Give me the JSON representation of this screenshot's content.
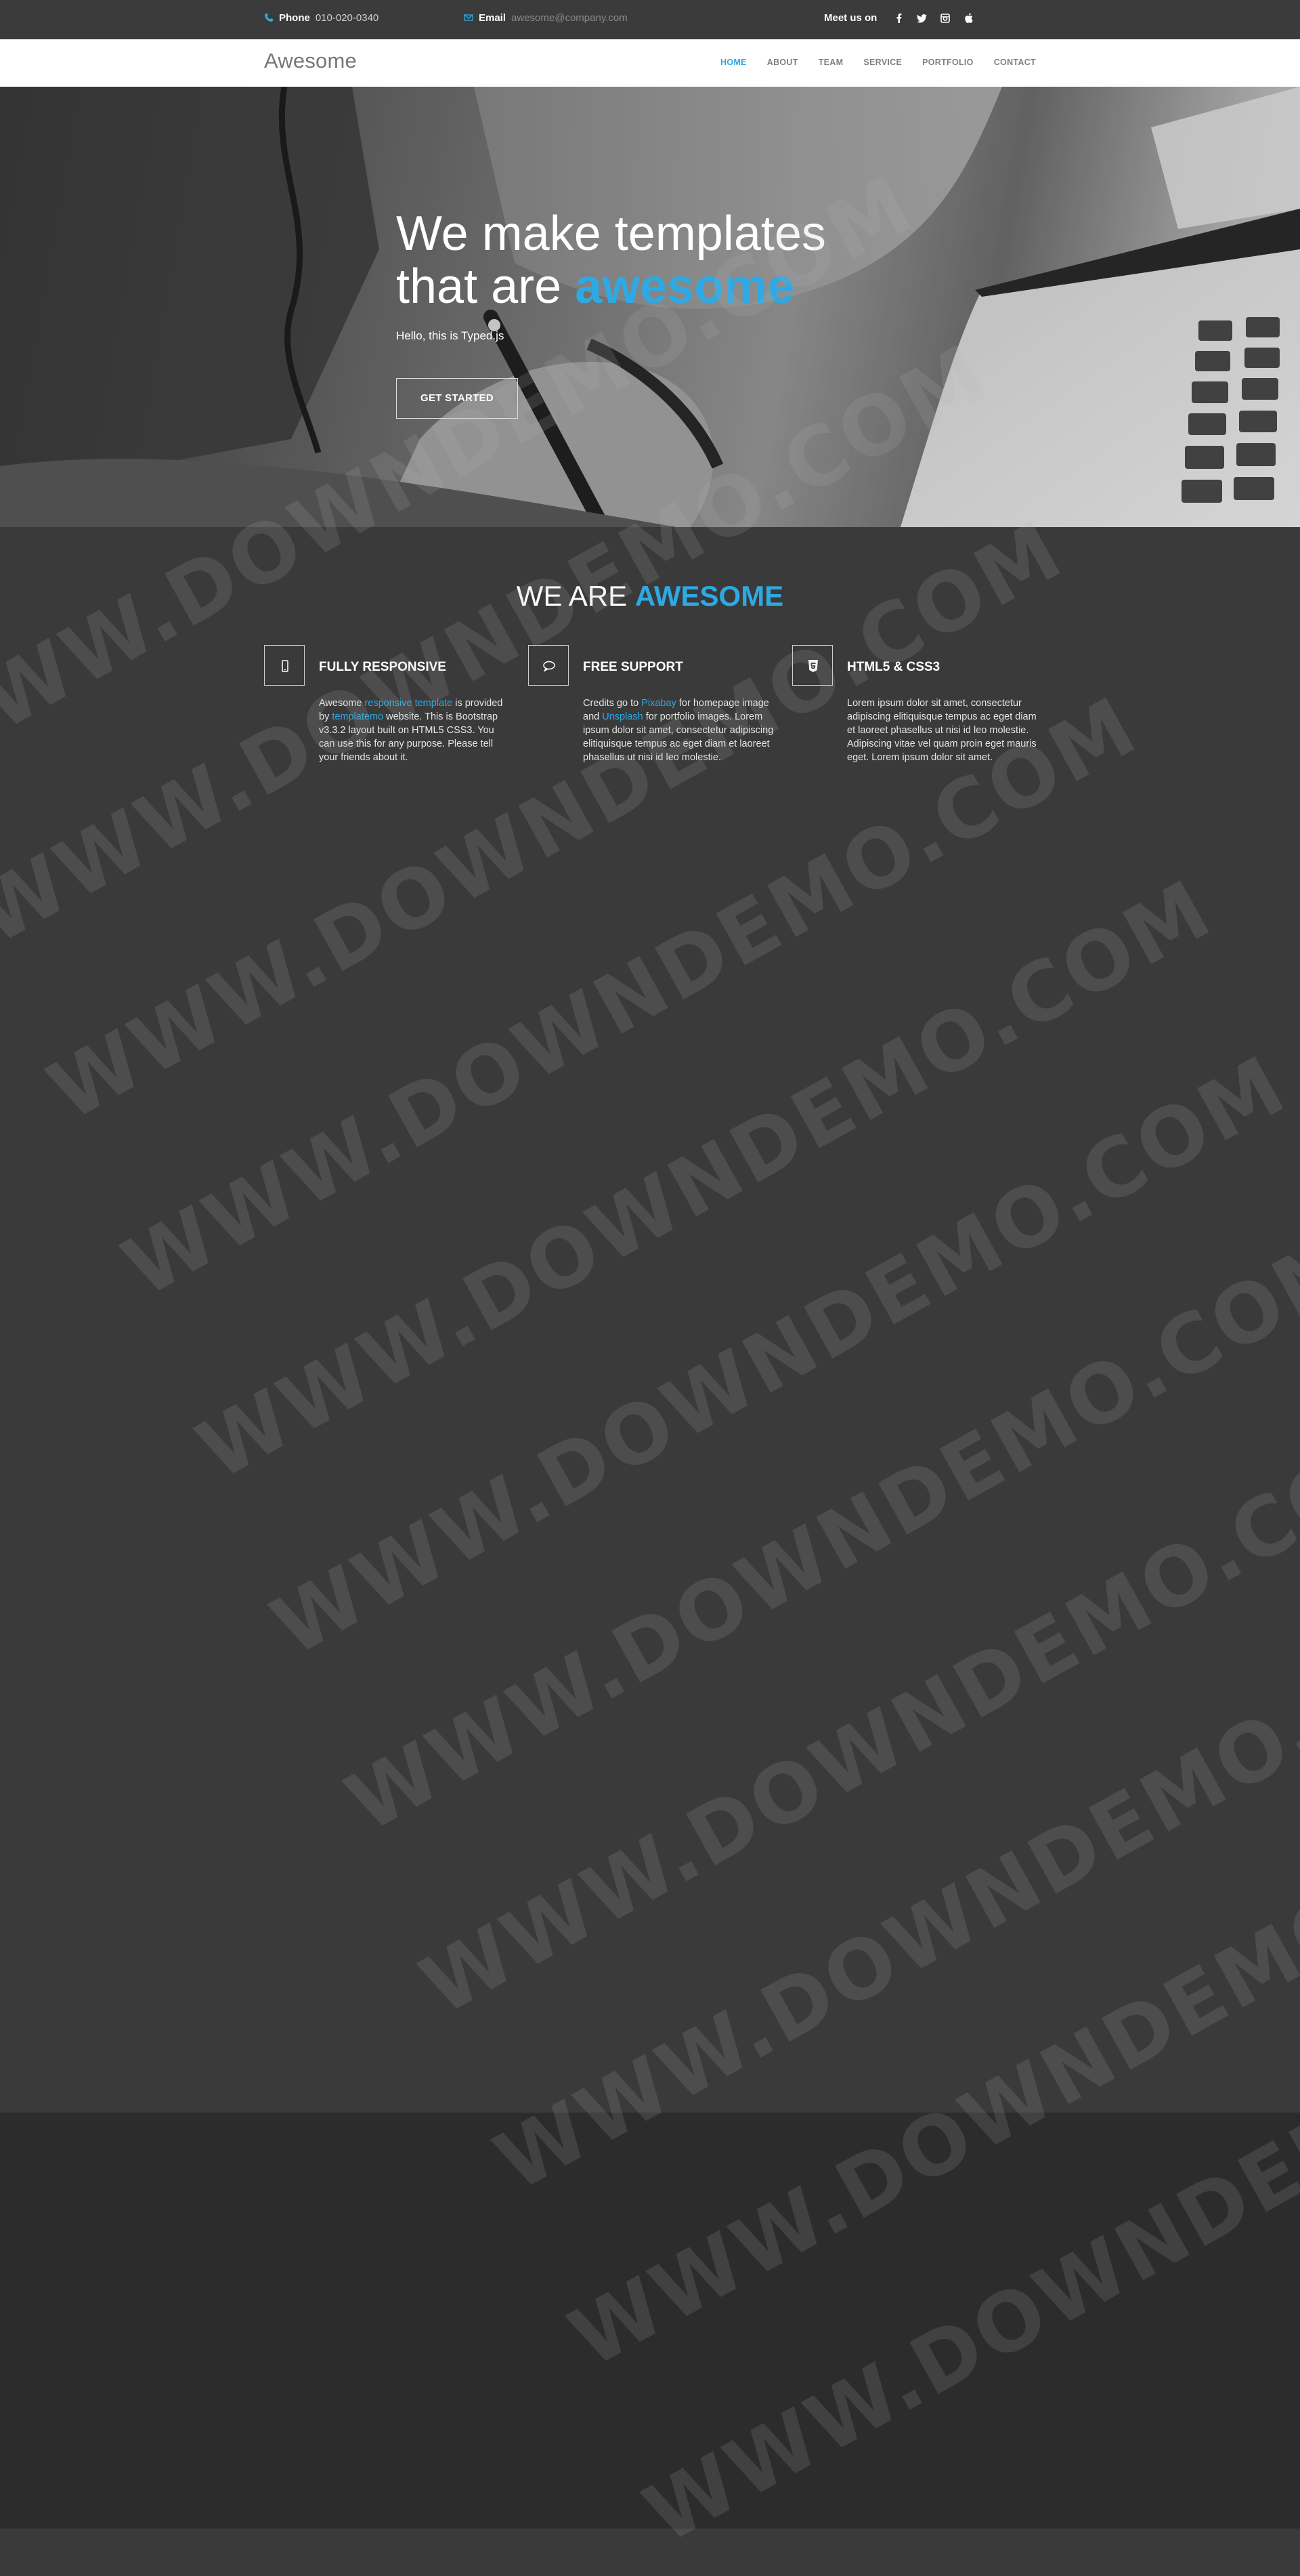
{
  "topbar": {
    "phone_label": "Phone",
    "phone_value": "010-020-0340",
    "email_label": "Email",
    "email_value": "awesome@company.com",
    "social_label": "Meet us on",
    "social_icons": [
      "facebook-icon",
      "twitter-icon",
      "instagram-icon",
      "apple-icon"
    ]
  },
  "nav": {
    "brand": "Awesome",
    "items": [
      {
        "label": "HOME",
        "active": true
      },
      {
        "label": "ABOUT",
        "active": false
      },
      {
        "label": "TEAM",
        "active": false
      },
      {
        "label": "SERVICE",
        "active": false
      },
      {
        "label": "PORTFOLIO",
        "active": false
      },
      {
        "label": "CONTACT",
        "active": false
      }
    ]
  },
  "hero": {
    "line1": "We make templates",
    "line2_prefix": "that are ",
    "line2_highlight": "awesome",
    "subtitle": "Hello, this is Typed.js",
    "button": "GET STARTED"
  },
  "about": {
    "title_prefix": "WE ARE ",
    "title_highlight": "AWESOME",
    "features": [
      {
        "icon": "mobile-icon",
        "title": "FULLY RESPONSIVE",
        "text_parts": [
          "Awesome ",
          "responsive template",
          " is provided by ",
          "templatemo",
          " website. This is Bootstrap v3.3.2 layout built on HTML5 CSS3. You can use this for any purpose. Please tell your friends about it."
        ]
      },
      {
        "icon": "comment-icon",
        "title": "FREE SUPPORT",
        "text_parts": [
          "Credits go to ",
          "Pixabay",
          " for homepage image and ",
          "Unsplash",
          " for portfolio images. Lorem ipsum dolor sit amet, consectetur adipiscing elitiquisque tempus ac eget diam et laoreet phasellus ut nisi id leo molestie."
        ]
      },
      {
        "icon": "html5-icon",
        "title": "HTML5 & CSS3",
        "text_parts": [
          "Lorem ipsum dolor sit amet, consectetur adipiscing elitiquisque tempus ac eget diam et laoreet phasellus ut nisi id leo molestie. Adipiscing vitae vel quam proin eget mauris eget. Lorem ipsum dolor sit amet."
        ]
      }
    ]
  },
  "watermark": "WWW.DOWNDEMO.COM",
  "colors": {
    "accent": "#2ea9e3",
    "topbar_bg": "#3b3b3b",
    "section_bg": "#3a3a3a",
    "dark_band_bg": "#2c2c2c"
  }
}
